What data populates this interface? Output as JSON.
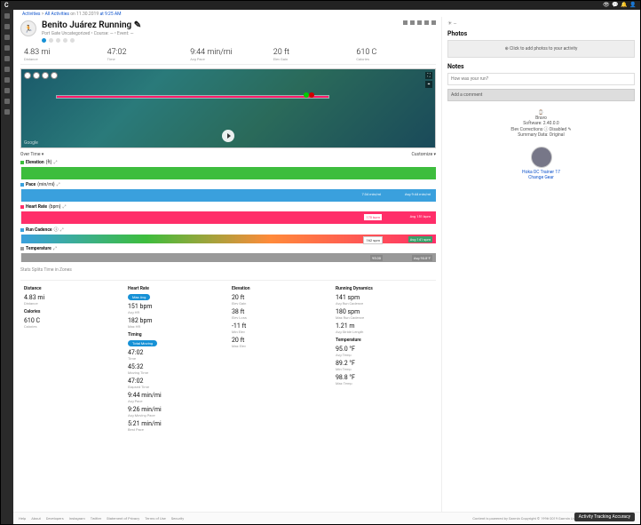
{
  "breadcrumb": {
    "a": "Activities",
    "b": "All Activities",
    "t": "on 11.30.2019",
    "time": "at 9:25 AM"
  },
  "header": {
    "title": "Benito Juárez Running",
    "sub": "Port Gate Uncategorized • Course: — • Event: —"
  },
  "stats": [
    {
      "v": "4.83 mi",
      "l": "Distance"
    },
    {
      "v": "47:02",
      "l": "Time"
    },
    {
      "v": "9:44 min/mi",
      "l": "Avg Pace"
    },
    {
      "v": "20 ft",
      "l": "Elev Gain"
    },
    {
      "v": "610 C",
      "l": "Calories"
    }
  ],
  "chartTabs": {
    "left": "Over Time ▾",
    "right": "Customize ▾"
  },
  "charts": {
    "elevation": {
      "label": "Elevation",
      "sub": "(ft)",
      "dot": "#3dbd3d",
      "avgTag": ""
    },
    "pace": {
      "label": "Pace",
      "sub": "(min/mi)",
      "dot": "#3aa0dd",
      "avgTag": "Avg 9:44 min/mi",
      "valTag": "7:34 min/mi"
    },
    "hr": {
      "label": "Heart Rate",
      "sub": "(bpm)",
      "dot": "#ff2e69",
      "avgTag": "Avg 151 bpm",
      "valTag": "170 bpm"
    },
    "cadence": {
      "label": "Run Cadence",
      "sub": "(spm)",
      "dot": "#3aa0dd",
      "avgTag": "Avg 141 spm",
      "valTag": "162 spm"
    },
    "temp": {
      "label": "Temperature",
      "sub": "(°F)",
      "dot": "#999",
      "avgTag": "Avg 93.8°F",
      "valTag": "95.00"
    }
  },
  "tabs": "Stats     Splits     Time in Zones",
  "detail": {
    "distance": {
      "h": "Distance",
      "v1": "4.83 mi",
      "l1": "Distance"
    },
    "calories": {
      "h": "Calories",
      "v1": "610 C",
      "l1": "Calories"
    },
    "hr": {
      "h": "Heart Rate",
      "pill": "Max     Avg",
      "v1": "151 bpm",
      "l1": "Avg HR",
      "v2": "182 bpm",
      "l2": "Max HR"
    },
    "timing": {
      "h": "Timing",
      "pill": "Total     Moving",
      "v1": "47:02",
      "l1": "Time",
      "v2": "45:32",
      "l2": "Moving Time",
      "v3": "47:02",
      "l3": "Elapsed Time",
      "v4": "9:44 min/mi",
      "l4": "Avg Pace",
      "v5": "9:26 min/mi",
      "l5": "Avg Moving Pace",
      "v6": "5:21 min/mi",
      "l6": "Best Pace"
    },
    "elev": {
      "h": "Elevation",
      "v1": "20 ft",
      "l1": "Elev Gain",
      "v2": "38 ft",
      "l2": "Elev Loss",
      "v3": "-11 ft",
      "l3": "Min Elev",
      "v4": "20 ft",
      "l4": "Max Elev"
    },
    "dyn": {
      "h": "Running Dynamics",
      "v1": "141 spm",
      "l1": "Avg Run Cadence",
      "v2": "180 spm",
      "l2": "Max Run Cadence",
      "v3": "1.21 m",
      "l3": "Avg Stride Length"
    },
    "temp": {
      "h": "Temperature",
      "v1": "95.0 °F",
      "l1": "Avg Temp",
      "v2": "89.2 °F",
      "l2": "Min Temp",
      "v3": "98.8 °F",
      "l3": "Max Temp"
    }
  },
  "right": {
    "photos": {
      "h": "Photos",
      "box": "⊕ Click to add photos to your activity"
    },
    "notes": {
      "h": "Notes",
      "ph": "How was your run?",
      "comment": "Add a comment"
    },
    "device": {
      "name": "Bravo",
      "sw": "Software: 2.40.0.0",
      "elev": "Elev Corrections ⓘ Disabled ✎",
      "src": "Summary Data: Original"
    },
    "gear": {
      "name": "Hoka DC Trainer 17",
      "action": "Change Gear"
    }
  },
  "footer": {
    "links": [
      "Help",
      "About",
      "Developers",
      "Instagram",
      "Twitter",
      "Statement of Privacy",
      "Terms of Use",
      "Security"
    ],
    "copy": "Content is powered by Garmin   Copyright © 1996-2019 Garmin Ltd. or its subsidiaries | Version: 4.27.1.0",
    "accuracy": "Activity Tracking Accuracy"
  },
  "map": {
    "google": "Google"
  }
}
